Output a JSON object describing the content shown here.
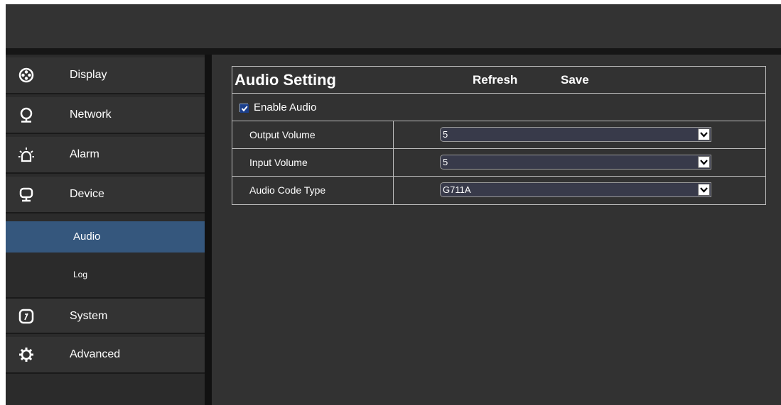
{
  "sidebar": {
    "items": [
      {
        "label": "Display",
        "icon": "film-reel-icon"
      },
      {
        "label": "Network",
        "icon": "network-icon"
      },
      {
        "label": "Alarm",
        "icon": "alarm-light-icon"
      },
      {
        "label": "Device",
        "icon": "monitor-icon"
      },
      {
        "label": "System",
        "icon": "clock-icon"
      },
      {
        "label": "Advanced",
        "icon": "gear-icon"
      }
    ],
    "sub_items": [
      {
        "label": "Audio",
        "active": true
      },
      {
        "label": "Log",
        "active": false
      }
    ]
  },
  "panel": {
    "title": "Audio Setting",
    "refresh_label": "Refresh",
    "save_label": "Save",
    "enable_audio": {
      "label": "Enable Audio",
      "checked": true
    },
    "rows": [
      {
        "label": "Output Volume",
        "value": "5"
      },
      {
        "label": "Input Volume",
        "value": "5"
      },
      {
        "label": "Audio Code Type",
        "value": "G711A"
      }
    ]
  },
  "colors": {
    "active_sub_item": "#35577d",
    "background": "#323232",
    "border": "#bdbdbd"
  }
}
